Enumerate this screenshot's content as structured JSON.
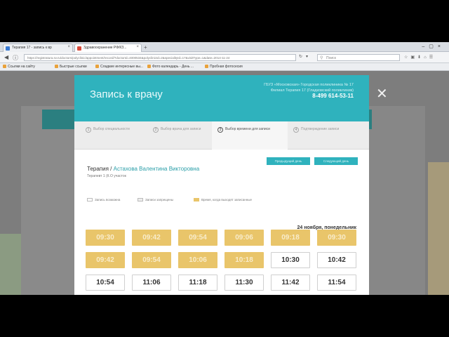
{
  "browser": {
    "tabs": [
      {
        "label": "Терапия 17 - запись к вр",
        "favicon_color": "#3a7bd5"
      },
      {
        "label": "Здравоохранение РФ/КЗ...",
        "favicon_color": "#d94a3a"
      }
    ],
    "url": "https://registratura.sv.ru/doctors/polyclinic/appointment/record/?doctorId=4000534&polyclinicId=2&specialityId=17&visitType=1&date=2014-11-24",
    "search_placeholder": "Поиск",
    "bookmarks": [
      "Ссылки на сайту",
      "Быстрые ссылки",
      "Сладкие интересные вы...",
      "Фото календарь - День ...",
      "Пробная фотосесия"
    ]
  },
  "modal": {
    "title": "Запись к врачу",
    "info_line1": "ГБУЗ «Московская» Городская поликлиника № 17",
    "info_line2": "Филиал Терапия 17 (Гладковский поликлиник)",
    "phone": "8-499 614-53-11",
    "close_icon": "close-icon",
    "steps": [
      {
        "num": "1",
        "label": "Выбор специальности"
      },
      {
        "num": "2",
        "label": "Выбор врача для записи"
      },
      {
        "num": "3",
        "label": "Выбор времени для записи"
      },
      {
        "num": "4",
        "label": "Подтверждение записи"
      }
    ],
    "date": "24 ноября, понедельник",
    "buttons": [
      "Предыдущий день",
      "Следующий день"
    ],
    "doctor_prefix": "Терапия /",
    "doctor_name": "Астахова Валентина Викторовна",
    "doctor_sub": "Терапевт 1 (К.О участок",
    "legend": [
      "Запись возможна",
      "Записи запрещены",
      "Время, когда выходят записанные"
    ],
    "slots": [
      {
        "time": "09:30",
        "status": "busy"
      },
      {
        "time": "09:42",
        "status": "busy"
      },
      {
        "time": "09:54",
        "status": "busy"
      },
      {
        "time": "09:06",
        "status": "busy"
      },
      {
        "time": "09:18",
        "status": "busy"
      },
      {
        "time": "09:30",
        "status": "busy"
      },
      {
        "time": "09:42",
        "status": "busy"
      },
      {
        "time": "09:54",
        "status": "busy"
      },
      {
        "time": "10:06",
        "status": "busy"
      },
      {
        "time": "10:18",
        "status": "busy"
      },
      {
        "time": "10:30",
        "status": "free"
      },
      {
        "time": "10:42",
        "status": "free"
      },
      {
        "time": "10:54",
        "status": "free"
      },
      {
        "time": "11:06",
        "status": "free"
      },
      {
        "time": "11:18",
        "status": "free"
      },
      {
        "time": "11:30",
        "status": "free"
      },
      {
        "time": "11:42",
        "status": "free"
      },
      {
        "time": "11:54",
        "status": "free"
      },
      {
        "time": "",
        "status": "free"
      },
      {
        "time": "",
        "status": "free"
      }
    ],
    "colors": {
      "accent": "#2fb2bd",
      "busy": "#e9c56a"
    }
  }
}
